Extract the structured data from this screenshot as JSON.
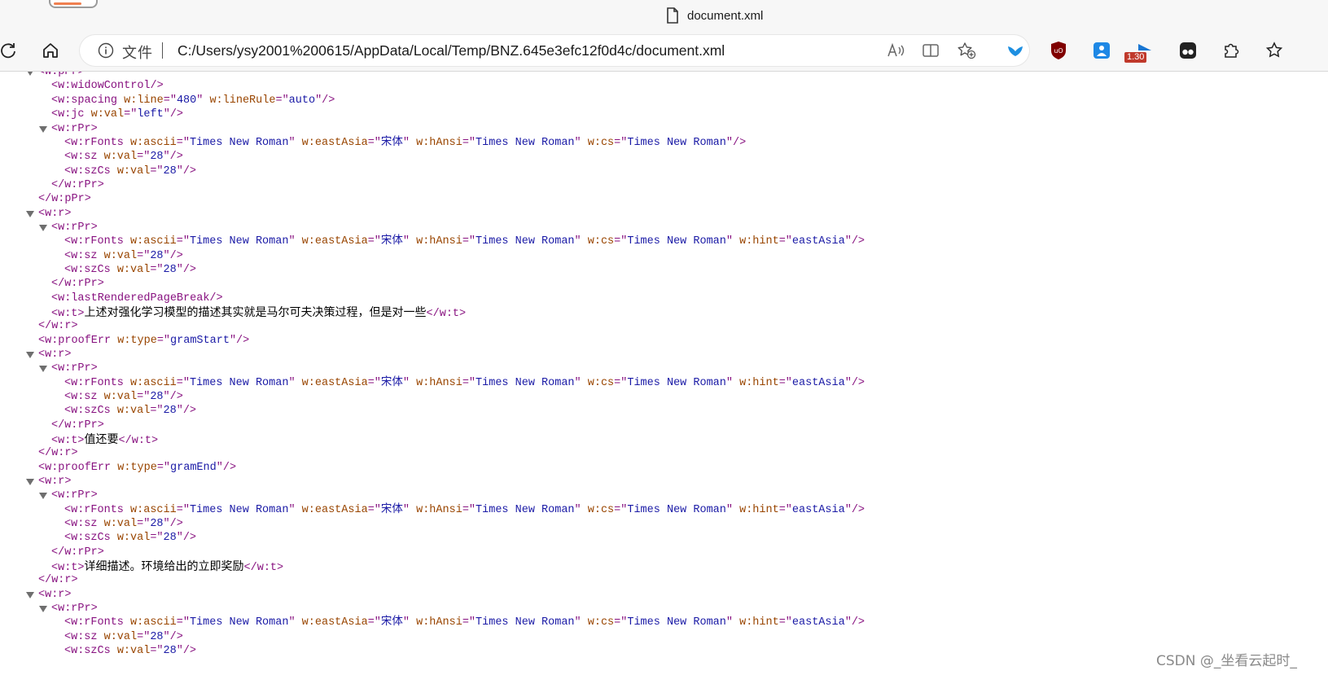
{
  "window": {
    "tab_title": "document.xml"
  },
  "toolbar": {
    "scheme_label": "文件",
    "url": "C:/Users/ysy2001%200615/AppData/Local/Temp/BNZ.645e3efc12f0d4c/document.xml",
    "extension_badge": "1.30"
  },
  "xml": {
    "l01": {
      "tag": "<w:pPr>"
    },
    "l02": {
      "tag": "<w:widowControl/>"
    },
    "l03": {
      "open": "<w:spacing ",
      "a1": "w:line",
      "eq1": "=\"",
      "v1": "480",
      "q1": "\" ",
      "a2": "w:lineRule",
      "eq2": "=\"",
      "v2": "auto",
      "close": "\"/>"
    },
    "l04": {
      "open": "<w:jc ",
      "a1": "w:val",
      "eq1": "=\"",
      "v1": "left",
      "close": "\"/>"
    },
    "l05": {
      "tag": "<w:rPr>"
    },
    "l06": {
      "open": "<w:rFonts ",
      "a1": "w:ascii",
      "v1": "Times New Roman",
      "a2": "w:eastAsia",
      "v2": "宋体",
      "a3": "w:hAnsi",
      "v3": "Times New Roman",
      "a4": "w:cs",
      "v4": "Times New Roman"
    },
    "l07": {
      "open": "<w:sz ",
      "a1": "w:val",
      "v1": "28"
    },
    "l08": {
      "open": "<w:szCs ",
      "a1": "w:val",
      "v1": "28"
    },
    "l09": {
      "tag": "</w:rPr>"
    },
    "l10": {
      "tag": "</w:pPr>"
    },
    "l11": {
      "tag": "<w:r>"
    },
    "l12": {
      "tag": "<w:rPr>"
    },
    "l13": {
      "open": "<w:rFonts ",
      "a1": "w:ascii",
      "v1": "Times New Roman",
      "a2": "w:eastAsia",
      "v2": "宋体",
      "a3": "w:hAnsi",
      "v3": "Times New Roman",
      "a4": "w:cs",
      "v4": "Times New Roman",
      "a5": "w:hint",
      "v5": "eastAsia"
    },
    "l14": {
      "open": "<w:sz ",
      "a1": "w:val",
      "v1": "28"
    },
    "l15": {
      "open": "<w:szCs ",
      "a1": "w:val",
      "v1": "28"
    },
    "l16": {
      "tag": "</w:rPr>"
    },
    "l17": {
      "tag": "<w:lastRenderedPageBreak/>"
    },
    "l18": {
      "open": "<w:t>",
      "text": "上述对强化学习模型的描述其实就是马尔可夫决策过程，但是对一些",
      "close": "</w:t>"
    },
    "l19": {
      "tag": "</w:r>"
    },
    "l20": {
      "open": "<w:proofErr ",
      "a1": "w:type",
      "v1": "gramStart"
    },
    "l21": {
      "tag": "<w:r>"
    },
    "l22": {
      "tag": "<w:rPr>"
    },
    "l23": {
      "open": "<w:rFonts ",
      "a1": "w:ascii",
      "v1": "Times New Roman",
      "a2": "w:eastAsia",
      "v2": "宋体",
      "a3": "w:hAnsi",
      "v3": "Times New Roman",
      "a4": "w:cs",
      "v4": "Times New Roman",
      "a5": "w:hint",
      "v5": "eastAsia"
    },
    "l24": {
      "open": "<w:sz ",
      "a1": "w:val",
      "v1": "28"
    },
    "l25": {
      "open": "<w:szCs ",
      "a1": "w:val",
      "v1": "28"
    },
    "l26": {
      "tag": "</w:rPr>"
    },
    "l27": {
      "open": "<w:t>",
      "text": "值还要",
      "close": "</w:t>"
    },
    "l28": {
      "tag": "</w:r>"
    },
    "l29": {
      "open": "<w:proofErr ",
      "a1": "w:type",
      "v1": "gramEnd"
    },
    "l30": {
      "tag": "<w:r>"
    },
    "l31": {
      "tag": "<w:rPr>"
    },
    "l32": {
      "open": "<w:rFonts ",
      "a1": "w:ascii",
      "v1": "Times New Roman",
      "a2": "w:eastAsia",
      "v2": "宋体",
      "a3": "w:hAnsi",
      "v3": "Times New Roman",
      "a4": "w:cs",
      "v4": "Times New Roman",
      "a5": "w:hint",
      "v5": "eastAsia"
    },
    "l33": {
      "open": "<w:sz ",
      "a1": "w:val",
      "v1": "28"
    },
    "l34": {
      "open": "<w:szCs ",
      "a1": "w:val",
      "v1": "28"
    },
    "l35": {
      "tag": "</w:rPr>"
    },
    "l36": {
      "open": "<w:t>",
      "text": "详细描述。环境给出的立即奖励",
      "close": "</w:t>"
    },
    "l37": {
      "tag": "</w:r>"
    },
    "l38": {
      "tag": "<w:r>"
    },
    "l39": {
      "tag": "<w:rPr>"
    },
    "l40": {
      "open": "<w:rFonts ",
      "a1": "w:ascii",
      "v1": "Times New Roman",
      "a2": "w:eastAsia",
      "v2": "宋体",
      "a3": "w:hAnsi",
      "v3": "Times New Roman",
      "a4": "w:cs",
      "v4": "Times New Roman",
      "a5": "w:hint",
      "v5": "eastAsia"
    },
    "l41": {
      "open": "<w:sz ",
      "a1": "w:val",
      "v1": "28"
    },
    "l42": {
      "open": "<w:szCs ",
      "a1": "w:val",
      "v1": "28"
    }
  },
  "watermark": "CSDN @_坐看云起时_",
  "colors": {
    "tag": "#881280",
    "attribute_name": "#994500",
    "attribute_value": "#1a1aa6",
    "text": "#000000",
    "chrome_bg": "#f7f7f7"
  }
}
